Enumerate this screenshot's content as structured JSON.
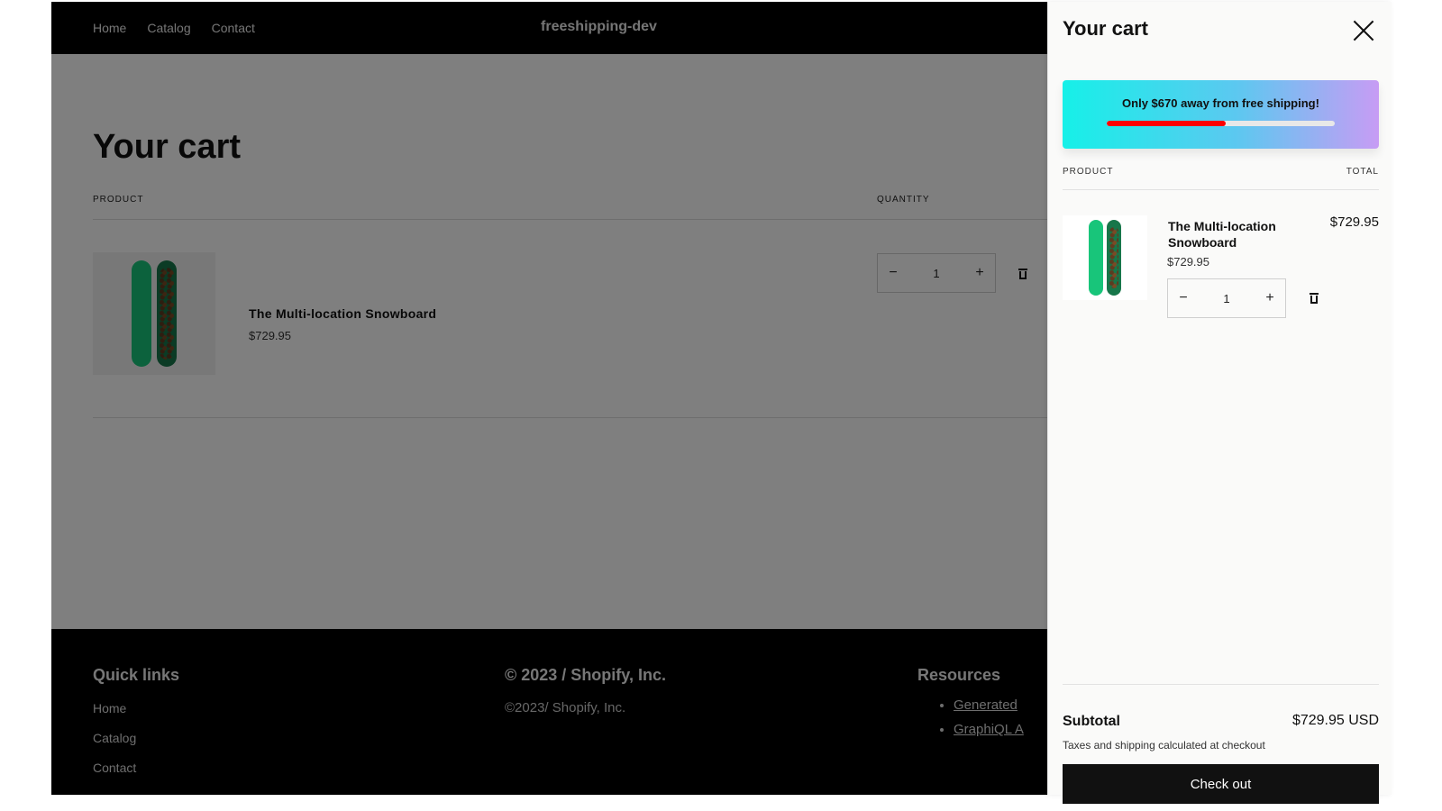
{
  "nav": {
    "links": [
      "Home",
      "Catalog",
      "Contact"
    ],
    "store_name": "freeshipping-dev"
  },
  "cart_page": {
    "title": "Your cart",
    "col_product": "PRODUCT",
    "col_quantity": "QUANTITY",
    "item": {
      "name": "The Multi-location Snowboard",
      "price": "$729.95",
      "quantity": "1"
    },
    "qty_minus": "−",
    "qty_plus": "+"
  },
  "footer": {
    "quick_links_title": "Quick links",
    "quick_links": [
      "Home",
      "Catalog",
      "Contact"
    ],
    "copyright_title": "© 2023 / Shopify, Inc.",
    "copyright_text": "©2023/ Shopify, Inc.",
    "resources_title": "Resources",
    "resources": [
      "Generated",
      "GraphiQL A"
    ]
  },
  "drawer": {
    "title": "Your cart",
    "shipping_message": "Only $670 away from free shipping!",
    "shipping_progress": 0.52,
    "col_product": "PRODUCT",
    "col_total": "TOTAL",
    "item": {
      "name": "The Multi-location Snowboard",
      "price": "$729.95",
      "total": "$729.95",
      "quantity": "1"
    },
    "qty_minus": "−",
    "qty_plus": "+",
    "subtotal_label": "Subtotal",
    "subtotal_value": "$729.95 USD",
    "tax_note": "Taxes and shipping calculated at checkout",
    "checkout_label": "Check out"
  },
  "colors": {
    "progress_fill": "#ff0000",
    "banner_start": "#16f0e8",
    "banner_end": "#c79cf4",
    "checkout_bg": "#111111"
  }
}
